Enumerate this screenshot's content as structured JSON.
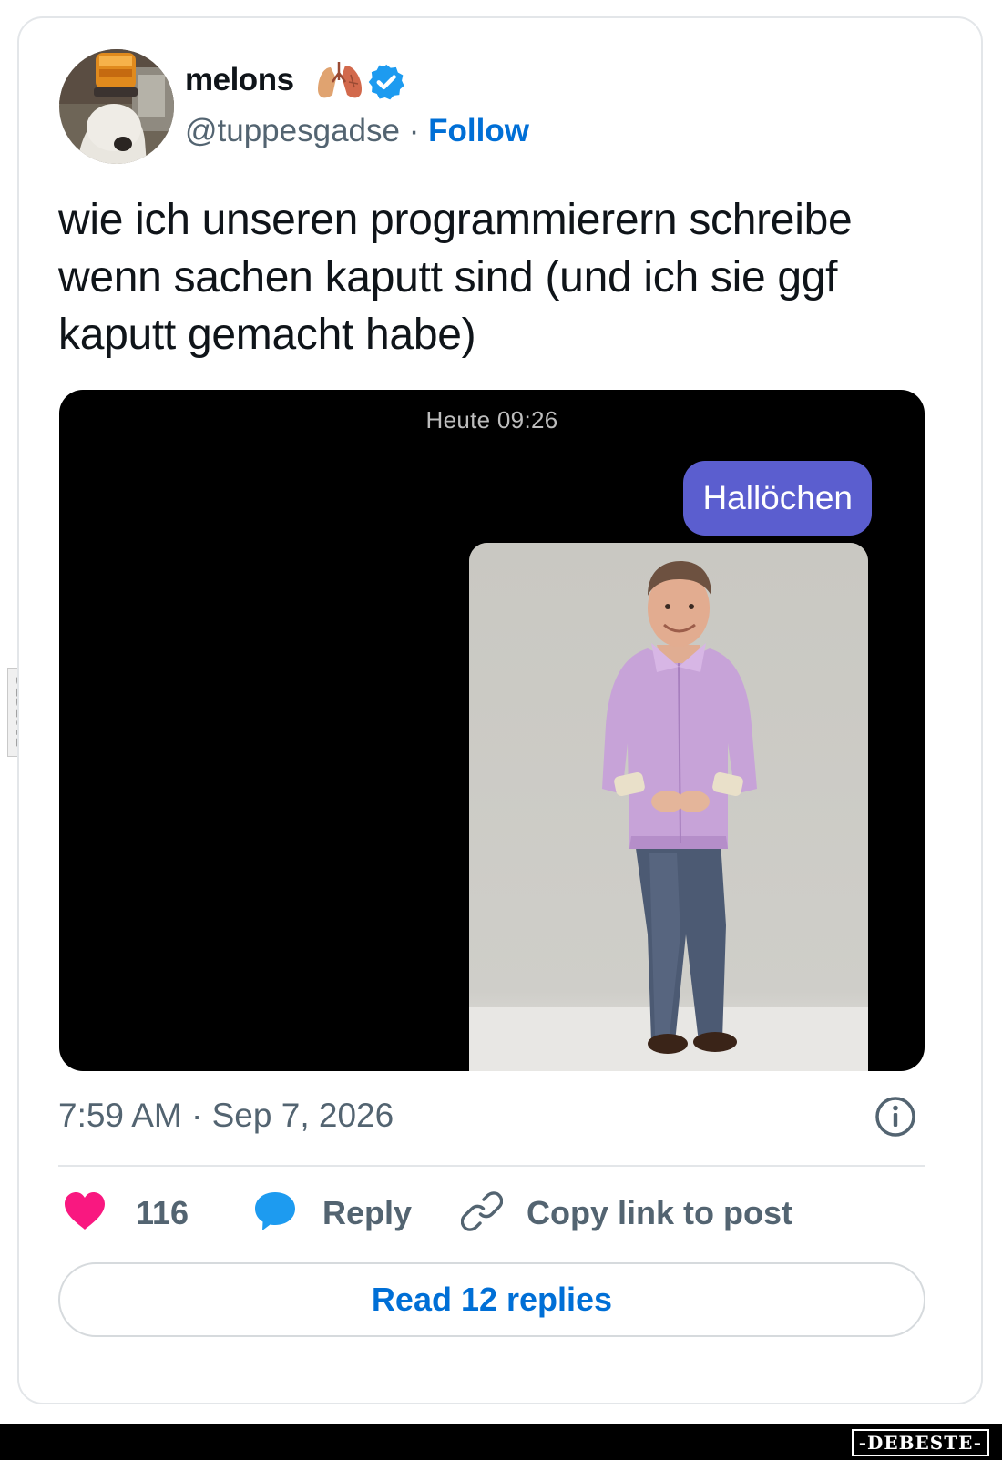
{
  "tweet": {
    "author": {
      "display_name": "melons",
      "emoji_icons": [
        "lungs-emoji-icon"
      ],
      "verified": true,
      "handle": "@tuppesgadse",
      "separator": "·",
      "follow_label": "Follow"
    },
    "text": "wie ich unseren programmierern schreibe wenn sachen kaputt sind (und ich sie ggf kaputt gemacht habe)",
    "media": {
      "chat_timestamp": "Heute 09:26",
      "message_bubble": "Hallöchen",
      "attached_photo": "person-standing-photo"
    },
    "timestamp": "7:59 AM · Sep 7, 2026",
    "actions": {
      "like_count": "116",
      "reply_label": "Reply",
      "copy_link_label": "Copy link to post"
    },
    "read_replies_label": "Read 12 replies"
  },
  "watermark": {
    "side_text": "DEBESTE",
    "bottom_logo": "-DEBESTE-"
  },
  "colors": {
    "link_blue": "#006fd6",
    "verified_blue": "#1d9bf0",
    "heart_pink": "#f91880",
    "reply_blue": "#1d9bf0",
    "bubble_purple": "#5b5ecf",
    "muted_text": "#536471"
  }
}
